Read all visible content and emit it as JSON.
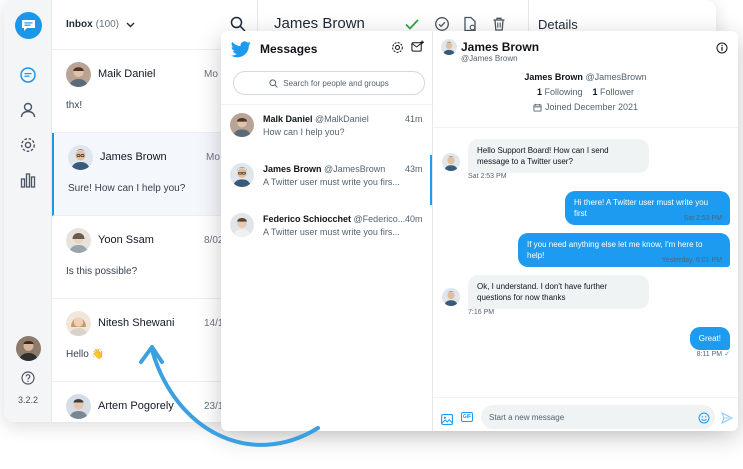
{
  "colors": {
    "accent": "#1c96e8",
    "twitter_blue": "#1d9bf0",
    "arrow": "#3aa0e0"
  },
  "rail": {
    "logo_icon": "chat-bubble-icon",
    "icons": [
      "chat-icon",
      "user-icon",
      "gear-icon",
      "bar-chart-icon"
    ],
    "help_icon": "help-circle-icon",
    "version": "3.2.2"
  },
  "inbox": {
    "title": "Inbox",
    "count": "(100)",
    "items": [
      {
        "name": "Maik Daniel",
        "date": "Mo",
        "message": "thx!"
      },
      {
        "name": "James Brown",
        "date": "Mo",
        "message": "Sure! How can I help you?"
      },
      {
        "name": "Yoon Ssam",
        "date": "8/02/",
        "message": "Is this possible?"
      },
      {
        "name": "Nitesh Shewani",
        "date": "14/12/",
        "message": "Hello 👋"
      },
      {
        "name": "Artem Pogorely",
        "date": "23/11/",
        "message": ""
      }
    ]
  },
  "back_chat": {
    "name": "James Brown"
  },
  "details": {
    "title": "Details"
  },
  "twitter": {
    "title": "Messages",
    "search_placeholder": "Search for people and groups",
    "conversations": [
      {
        "name": "Malk Daniel",
        "handle": "@MalkDaniel",
        "time": "41m",
        "message": "How can I help you?"
      },
      {
        "name": "James Brown",
        "handle": "@JamesBrown",
        "time": "43m",
        "message": "A Twitter user must write you firs..."
      },
      {
        "name": "Federico Schiocchet",
        "handle": "@Federico...",
        "time": "40m",
        "message": "A Twitter user must write you firs..."
      }
    ],
    "chat": {
      "name": "James Brown",
      "handle": "@James Brown",
      "profile_name": "James Brown",
      "profile_handle": "@JamesBrown",
      "following_count": "1",
      "following_label": "Following",
      "followers_count": "1",
      "followers_label": "Follower",
      "joined": "Joined December 2021",
      "messages": [
        {
          "dir": "in",
          "text": "Hello Support Board! How can I send message to a Twitter user?",
          "time": "Sat 2:53 PM"
        },
        {
          "dir": "out",
          "text": "Hi there! A Twitter user must write you first",
          "time": "Sat 2:53 PM"
        },
        {
          "dir": "out",
          "text": "If you need anything else let me know, I'm here to help!",
          "time": "Yesterday, 6:01 PM"
        },
        {
          "dir": "in",
          "text": "Ok, I understand. I don't have further questions for now thanks",
          "time": "7:16 PM"
        },
        {
          "dir": "out",
          "text": "Great!",
          "time": "8:11 PM"
        }
      ],
      "input_placeholder": "Start a new message",
      "gif_label": "GIF"
    }
  }
}
